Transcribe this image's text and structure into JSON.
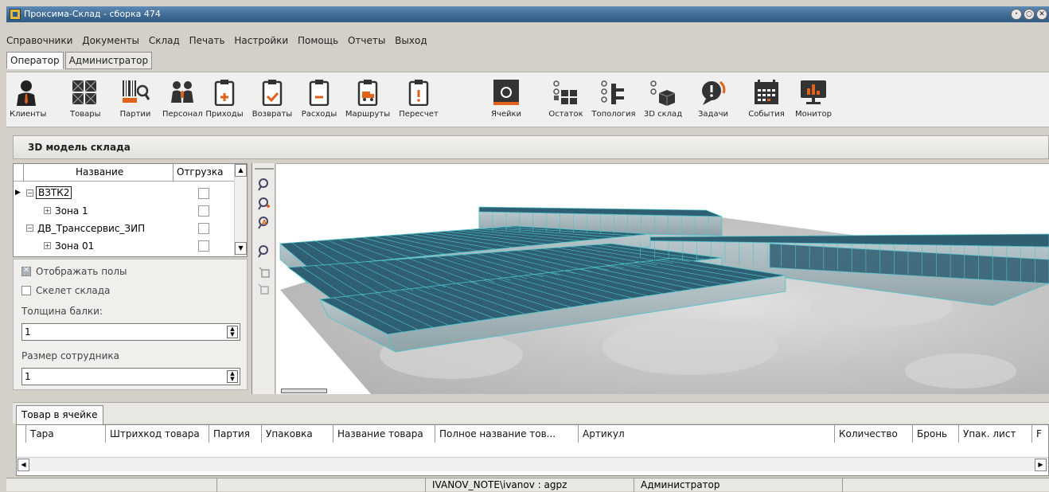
{
  "window": {
    "title": "Проксима-Склад - сборка 474"
  },
  "menu": [
    "Справочники",
    "Документы",
    "Склад",
    "Печать",
    "Настройки",
    "Помощь",
    "Отчеты",
    "Выход"
  ],
  "role_tabs": [
    "Оператор",
    "Администратор"
  ],
  "toolbar": [
    {
      "label": "Клиенты",
      "icon": "person-icon"
    },
    {
      "label": "Товары",
      "icon": "grid-boxes-icon"
    },
    {
      "label": "Партии",
      "icon": "barcode-search-icon"
    },
    {
      "label": "Персонал",
      "icon": "people-icon"
    },
    {
      "label": "Приходы",
      "icon": "clipboard-plus-icon"
    },
    {
      "label": "Возвраты",
      "icon": "clipboard-check-icon"
    },
    {
      "label": "Расходы",
      "icon": "clipboard-minus-icon"
    },
    {
      "label": "Маршруты",
      "icon": "clipboard-truck-icon"
    },
    {
      "label": "Пересчет",
      "icon": "clipboard-exclaim-icon"
    },
    {
      "label": "Ячейки",
      "icon": "cell-icon"
    },
    {
      "label": "Остаток",
      "icon": "stock-icon"
    },
    {
      "label": "Топология",
      "icon": "topology-icon"
    },
    {
      "label": "3D склад",
      "icon": "cube-3d-icon"
    },
    {
      "label": "Задачи",
      "icon": "task-bubble-icon"
    },
    {
      "label": "События",
      "icon": "calendar-icon"
    },
    {
      "label": "Монитор",
      "icon": "monitor-icon"
    }
  ],
  "panel": {
    "title": "3D модель склада"
  },
  "tree": {
    "headers": [
      "Название",
      "Отгрузка"
    ],
    "rows": [
      {
        "name": "ВЗТК2",
        "level": 0,
        "expanded": true,
        "checked": false
      },
      {
        "name": "Зона 1",
        "level": 1,
        "expanded": false,
        "checked": false
      },
      {
        "name": "ДВ_Транссервис_ЗИП",
        "level": 0,
        "expanded": true,
        "checked": false
      },
      {
        "name": "Зона 01",
        "level": 1,
        "expanded": false,
        "checked": false
      }
    ]
  },
  "options": {
    "show_floors": "Отображать полы",
    "show_floors_checked": true,
    "skeleton": "Скелет склада",
    "skeleton_checked": false,
    "beam_label": "Толщина балки:",
    "beam_value": "1",
    "worker_label": "Размер сотрудника",
    "worker_value": "1"
  },
  "bottom": {
    "tab": "Товар в ячейке",
    "columns": [
      "Тара",
      "Штрихкод товара",
      "Партия",
      "Упаковка",
      "Название товара",
      "Полное название тов...",
      "Артикул",
      "Количество",
      "Бронь",
      "Упак. лист",
      "F"
    ]
  },
  "status": {
    "user": "IVANOV_NOTE\\ivanov : agpz",
    "role": "Администратор"
  },
  "colors": {
    "accent": "#e0611a",
    "title_bar": "#3d6891",
    "rack_top": "#2f5f73",
    "rack_edge": "#4fc4cc"
  }
}
